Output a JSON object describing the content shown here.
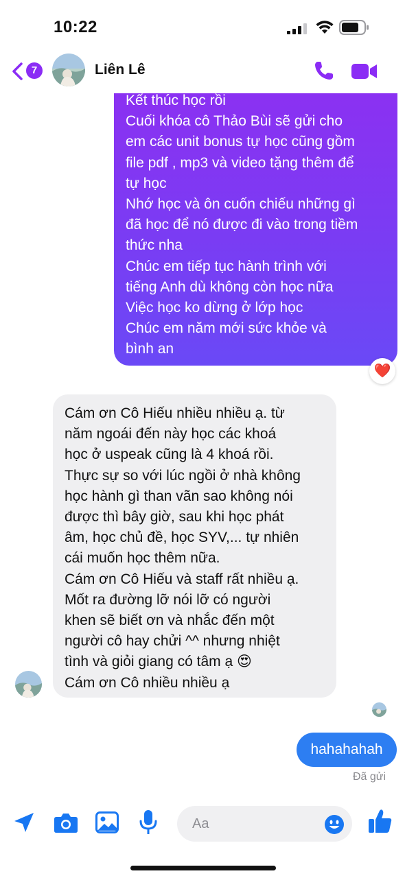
{
  "status_bar": {
    "time": "10:22"
  },
  "header": {
    "back_badge": "7",
    "contact_name": "Liên Lê"
  },
  "thread": {
    "outgoing_lines": [
      "Kết thúc học rồi",
      "Cuối khóa cô Thảo Bùi sẽ gửi cho",
      "em các unit bonus tự học cũng gồm",
      "file pdf , mp3 và video tặng thêm để",
      "tự học",
      "Nhớ học và ôn cuốn chiếu những gì",
      "đã học để nó được đi vào trong tiềm",
      "thức nha",
      "Chúc em tiếp tục hành trình với",
      "tiếng Anh dù không còn học nữa",
      "Việc học ko dừng ở lớp học",
      "Chúc em năm mới sức khỏe và",
      "bình an"
    ],
    "reaction": "❤️",
    "incoming_lines": [
      "Cám ơn Cô Hiếu nhiều nhiều ạ. từ",
      "năm ngoái đến này học các khoá",
      "học ở uspeak cũng là 4 khoá rồi.",
      "Thực sự so với lúc ngồi ở nhà không",
      "học hành gì than vãn sao không nói",
      "được thì bây giờ, sau khi học phát",
      "âm, học chủ đề, học SYV,... tự nhiên",
      "cái muốn học thêm nữa.",
      "Cám ơn Cô Hiếu và staff rất nhiều ạ.",
      "Mốt ra đường lỡ nói lỡ có người",
      "khen sẽ biết ơn và nhắc đến một",
      "người cô hay chửi ^^ nhưng nhiệt",
      "tình và giỏi giang có tâm ạ 😍",
      "Cám ơn Cô nhiều nhiều ạ"
    ],
    "my_message": "hahahahah",
    "sent_status": "Đã gửi"
  },
  "composer": {
    "placeholder": "Aa"
  },
  "colors": {
    "accent": "#8b2cf5",
    "outgoing_top": "#8c30f2",
    "outgoing_bottom": "#6a49f6",
    "my_bubble": "#2d7ef2",
    "incoming_bubble": "#efeff1",
    "composer_icons": "#1877f2"
  },
  "icons": {
    "header": [
      "chevron-left-icon",
      "phone-icon",
      "video-camera-icon"
    ],
    "composer": [
      "location-arrow-icon",
      "camera-icon",
      "image-icon",
      "microphone-icon",
      "emoji-icon",
      "thumbs-up-icon"
    ]
  }
}
